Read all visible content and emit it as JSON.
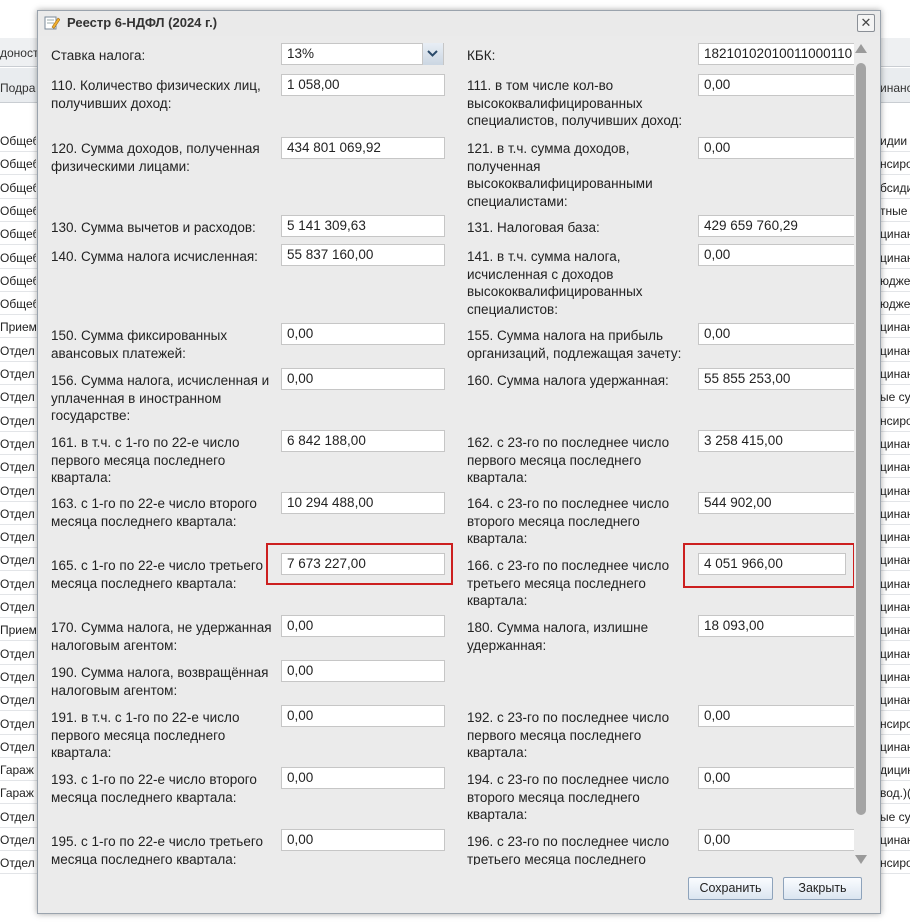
{
  "background_table": {
    "header_left": "доност",
    "header_sub_left": "Подра",
    "header_sub_right": "инанс",
    "left_cells": [
      "Общеб",
      "Общеб",
      "Общеб",
      "Общеб",
      "Общеб",
      "Общеб",
      "Общеб",
      "Общеб",
      "Прием",
      "Отдел",
      "Отдел",
      "Отдел",
      "Отдел",
      "Отдел",
      "Отдел",
      "Отдел",
      "Отдел",
      "Отдел",
      "Отдел",
      "Отдел",
      "Отдел",
      "Прием",
      "Отдел",
      "Отдел",
      "Отдел",
      "Отдел",
      "Отдел",
      "Гараж",
      "Гараж",
      "Отдел",
      "Отдел",
      "Отдел"
    ],
    "right_cells": [
      "идии",
      "нсиро",
      "бсиди",
      "тные",
      "цинан",
      "цинан",
      "юдже",
      "юдже",
      "цинан",
      "цинан",
      "цинан",
      "ые суб",
      "нсиро",
      "цинан",
      "цинан",
      "цинан",
      "цинан",
      "цинан",
      "цинан",
      "цинан",
      "цинан",
      "цинан",
      "цинан",
      "цинан",
      "цинан",
      "нсиро",
      "цинан",
      "дицин",
      "вод.)(",
      "ые суб",
      "цинан",
      "нсиро"
    ]
  },
  "dialog": {
    "title": "Реестр 6-НДФЛ (2024 г.)",
    "close_symbol": "✕"
  },
  "form": {
    "tax_rate": {
      "label": "Ставка налога:",
      "value": "13%"
    },
    "kbk": {
      "label": "КБК:",
      "value": "18210102010011000110"
    },
    "f110": {
      "label": "110. Количество физических лиц, получивших доход:",
      "value": "1 058,00"
    },
    "f111": {
      "label": "111. в том числе кол-во высококвалифицированных специалистов, получивших доход:",
      "value": "0,00"
    },
    "f120": {
      "label": "120. Сумма доходов, полученная физическими лицами:",
      "value": "434 801 069,92"
    },
    "f121": {
      "label": "121. в т.ч. сумма доходов, полученная высококвалифицированными специалистами:",
      "value": "0,00"
    },
    "f130": {
      "label": "130. Сумма вычетов и расходов:",
      "value": "5 141 309,63"
    },
    "f131": {
      "label": "131. Налоговая база:",
      "value": "429 659 760,29"
    },
    "f140": {
      "label": "140. Сумма налога исчисленная:",
      "value": "55 837 160,00"
    },
    "f141": {
      "label": "141. в т.ч. сумма налога, исчисленная с доходов высококвалифицированных специалистов:",
      "value": "0,00"
    },
    "f150": {
      "label": "150. Сумма фиксированных авансовых платежей:",
      "value": "0,00"
    },
    "f155": {
      "label": "155. Сумма налога на прибыль организаций, подлежащая зачету:",
      "value": "0,00"
    },
    "f156": {
      "label": "156. Сумма налога, исчисленная и уплаченная в иностранном государстве:",
      "value": "0,00"
    },
    "f160": {
      "label": "160. Сумма налога удержанная:",
      "value": "55 855 253,00"
    },
    "f161": {
      "label": "161. в т.ч. с 1-го по 22-е число первого месяца последнего квартала:",
      "value": "6 842 188,00"
    },
    "f162": {
      "label": "162. с 23-го по последнее число первого месяца последнего квартала:",
      "value": "3 258 415,00"
    },
    "f163": {
      "label": "163. с 1-го по 22-е число второго месяца последнего квартала:",
      "value": "10 294 488,00"
    },
    "f164": {
      "label": "164. с 23-го по последнее число второго месяца последнего квартала:",
      "value": "544 902,00"
    },
    "f165": {
      "label": "165. с 1-го по 22-е число третьего месяца последнего квартала:",
      "value": "7 673 227,00"
    },
    "f166": {
      "label": "166. с 23-го по последнее число третьего месяца последнего квартала:",
      "value": "4 051 966,00"
    },
    "f170": {
      "label": "170. Сумма налога, не удержанная налоговым агентом:",
      "value": "0,00"
    },
    "f180": {
      "label": "180. Сумма налога, излишне удержанная:",
      "value": "18 093,00"
    },
    "f190": {
      "label": "190. Сумма налога, возвращённая налоговым агентом:",
      "value": "0,00"
    },
    "f191": {
      "label": "191. в т.ч. с 1-го по 22-е число первого месяца последнего квартала:",
      "value": "0,00"
    },
    "f192": {
      "label": "192. с 23-го по последнее число первого месяца последнего квартала:",
      "value": "0,00"
    },
    "f193": {
      "label": "193. с 1-го по 22-е число второго месяца последнего квартала:",
      "value": "0,00"
    },
    "f194": {
      "label": "194. с 23-го по последнее число второго месяца последнего квартала:",
      "value": "0,00"
    },
    "f195": {
      "label": "195. с 1-го по 22-е число третьего месяца последнего квартала:",
      "value": "0,00"
    },
    "f196": {
      "label": "196. с 23-го по последнее число третьего месяца последнего",
      "value": "0,00"
    }
  },
  "footer": {
    "save_label": "Сохранить",
    "close_label": "Закрыть"
  },
  "colors": {
    "highlight": "#cc1f1f",
    "dialog_bg": "#ebebeb",
    "input_border": "#c6c6c6"
  }
}
